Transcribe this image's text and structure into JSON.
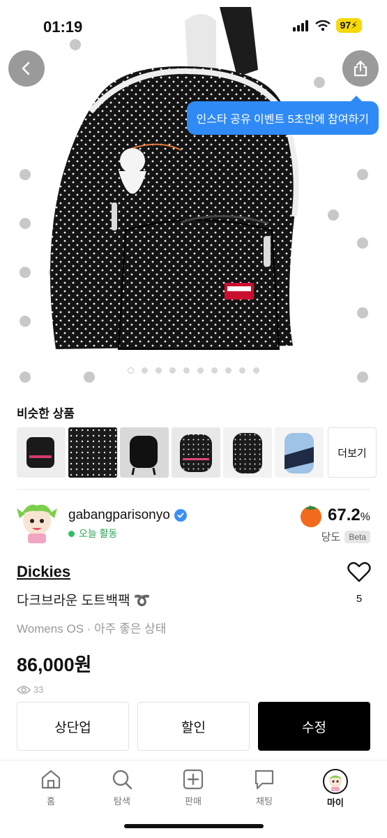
{
  "status_bar": {
    "time": "01:19",
    "battery": "97"
  },
  "colors": {
    "accent_blue": "#2f8af6",
    "online_green": "#2aa657",
    "primary_button": "#000000"
  },
  "icons": {
    "back": "chevron-left-icon",
    "share": "share-icon",
    "verified": "verified-badge-icon",
    "like": "heart-outline-icon",
    "views": "eye-icon"
  },
  "tooltip": {
    "text": "인스타 공유 이벤트 5초만에 참여하기"
  },
  "gallery": {
    "total_images": 10,
    "active_index": 0
  },
  "similar": {
    "title": "비슷한 상품",
    "more_label": "더보기",
    "items": [
      "thumb-1",
      "thumb-2",
      "thumb-3",
      "thumb-4",
      "thumb-5",
      "thumb-6"
    ]
  },
  "seller": {
    "name": "gabangparisonyo",
    "status": "오늘 활동",
    "temperature": "67.2",
    "temperature_unit": "%",
    "temperature_label": "당도",
    "beta_label": "Beta"
  },
  "product": {
    "brand": "Dickies",
    "name": "다크브라운 도트백팩 ➰",
    "meta": "Womens OS · 아주 좋은 상태",
    "price": "86,000원",
    "views": "33",
    "likes": "5"
  },
  "actions": {
    "bump": "상단업",
    "discount": "할인",
    "edit": "수정"
  },
  "tabs": [
    {
      "label": "홈"
    },
    {
      "label": "탐색"
    },
    {
      "label": "판매"
    },
    {
      "label": "채팅"
    },
    {
      "label": "마이"
    }
  ]
}
